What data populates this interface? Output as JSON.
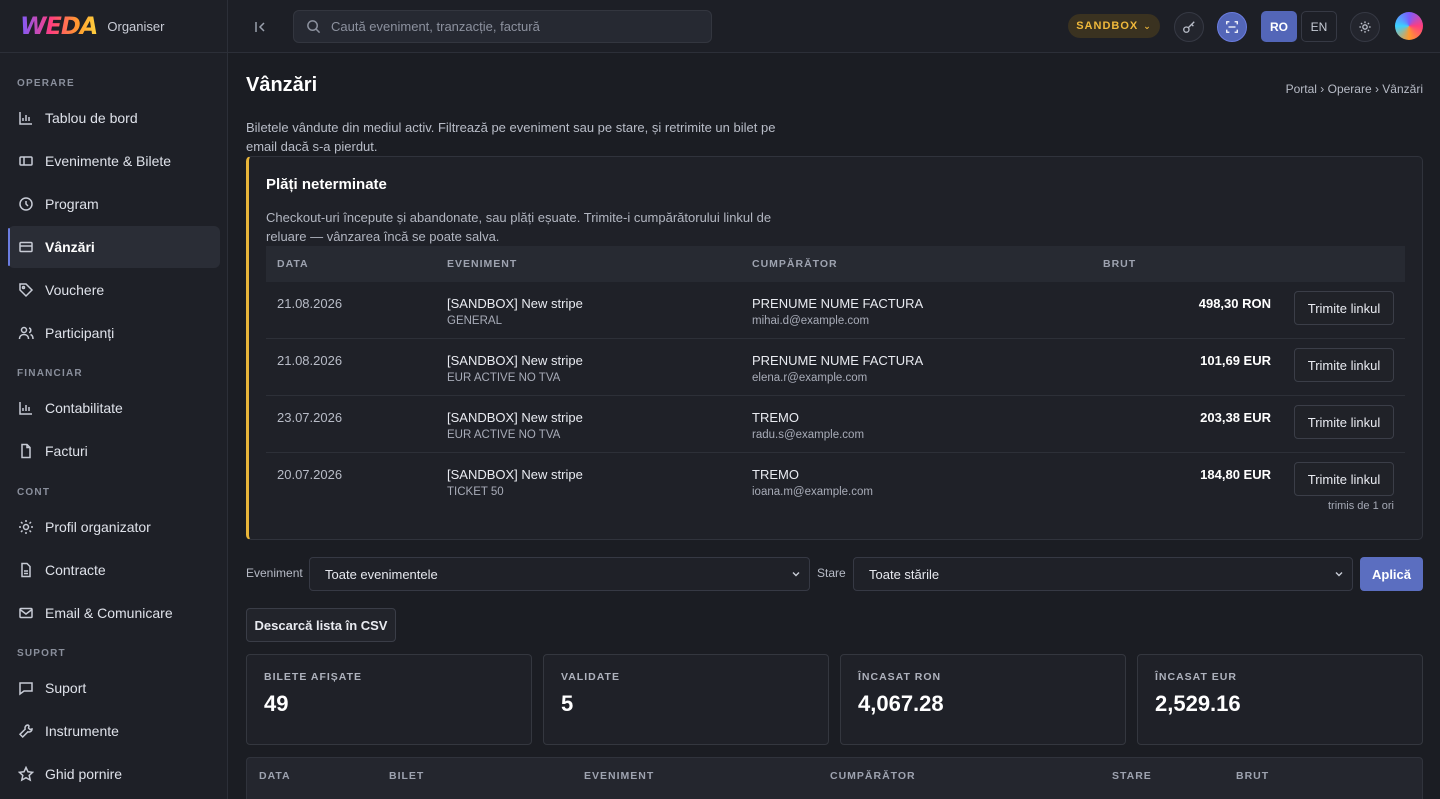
{
  "brand": {
    "logo": "WEDA",
    "subtitle": "Organiser"
  },
  "sidebar": {
    "sections": [
      {
        "label": "OPERARE"
      },
      {
        "label": "FINANCIAR"
      },
      {
        "label": "CONT"
      },
      {
        "label": "SUPORT"
      }
    ],
    "items": [
      {
        "label": "Tablou de bord",
        "icon": "chart-icon"
      },
      {
        "label": "Evenimente & Bilete",
        "icon": "ticket-icon"
      },
      {
        "label": "Program",
        "icon": "clock-icon"
      },
      {
        "label": "Vânzări",
        "icon": "card-icon",
        "active": true
      },
      {
        "label": "Vouchere",
        "icon": "tag-icon"
      },
      {
        "label": "Participanți",
        "icon": "users-icon"
      },
      {
        "label": "Contabilitate",
        "icon": "chart-icon"
      },
      {
        "label": "Facturi",
        "icon": "document-icon"
      },
      {
        "label": "Profil organizator",
        "icon": "gear-icon"
      },
      {
        "label": "Contracte",
        "icon": "contract-icon"
      },
      {
        "label": "Email & Comunicare",
        "icon": "mail-icon"
      },
      {
        "label": "Suport",
        "icon": "chat-icon"
      },
      {
        "label": "Instrumente",
        "icon": "wrench-icon"
      },
      {
        "label": "Ghid pornire",
        "icon": "star-icon"
      }
    ]
  },
  "topbar": {
    "search_placeholder": "Caută eveniment, tranzacție, factură",
    "environment": "SANDBOX",
    "lang_ro": "RO",
    "lang_en": "EN"
  },
  "page": {
    "title": "Vânzări",
    "breadcrumb": "Portal › Operare › Vânzări",
    "description": "Biletele vândute din mediul activ. Filtrează pe eveniment sau pe stare, și retrimite un bilet pe email dacă s-a pierdut."
  },
  "pending": {
    "title": "Plăți neterminate",
    "description": "Checkout-uri începute și abandonate, sau plăți eșuate. Trimite-i cumpărătorului linkul de reluare — vânzarea încă se poate salva.",
    "headers": {
      "date": "DATA",
      "event": "EVENIMENT",
      "buyer": "CUMPĂRĂTOR",
      "gross": "BRUT"
    },
    "rows": [
      {
        "date": "21.08.2026",
        "event": "[SANDBOX] New stripe",
        "ticket": "GENERAL",
        "buyer": "PRENUME NUME FACTURA",
        "email": "mihai.d@example.com",
        "amount": "498,30 RON",
        "action": "Trimite linkul",
        "note": ""
      },
      {
        "date": "21.08.2026",
        "event": "[SANDBOX] New stripe",
        "ticket": "EUR ACTIVE NO TVA",
        "buyer": "PRENUME NUME FACTURA",
        "email": "elena.r@example.com",
        "amount": "101,69 EUR",
        "action": "Trimite linkul",
        "note": ""
      },
      {
        "date": "23.07.2026",
        "event": "[SANDBOX] New stripe",
        "ticket": "EUR ACTIVE NO TVA",
        "buyer": "TREMO",
        "email": "radu.s@example.com",
        "amount": "203,38 EUR",
        "action": "Trimite linkul",
        "note": ""
      },
      {
        "date": "20.07.2026",
        "event": "[SANDBOX] New stripe",
        "ticket": "TICKET 50",
        "buyer": "TREMO",
        "email": "ioana.m@example.com",
        "amount": "184,80 EUR",
        "action": "Trimite linkul",
        "note": "trimis de 1 ori"
      }
    ]
  },
  "filters": {
    "event_label": "Eveniment",
    "event_value": "Toate evenimentele",
    "status_label": "Stare",
    "status_value": "Toate stările",
    "apply": "Aplică",
    "csv": "Descarcă lista în CSV"
  },
  "stats": [
    {
      "label": "BILETE AFIȘATE",
      "value": "49"
    },
    {
      "label": "VALIDATE",
      "value": "5"
    },
    {
      "label": "ÎNCASAT RON",
      "value": "4,067.28"
    },
    {
      "label": "ÎNCASAT EUR",
      "value": "2,529.16"
    }
  ],
  "sales_table": {
    "headers": {
      "date": "DATA",
      "ticket": "BILET",
      "event": "EVENIMENT",
      "buyer": "CUMPĂRĂTOR",
      "status": "STARE",
      "gross": "BRUT"
    }
  },
  "colors": {
    "accent": "#5b6ec0",
    "warning": "#e8b53a",
    "background": "#1b1d23"
  }
}
